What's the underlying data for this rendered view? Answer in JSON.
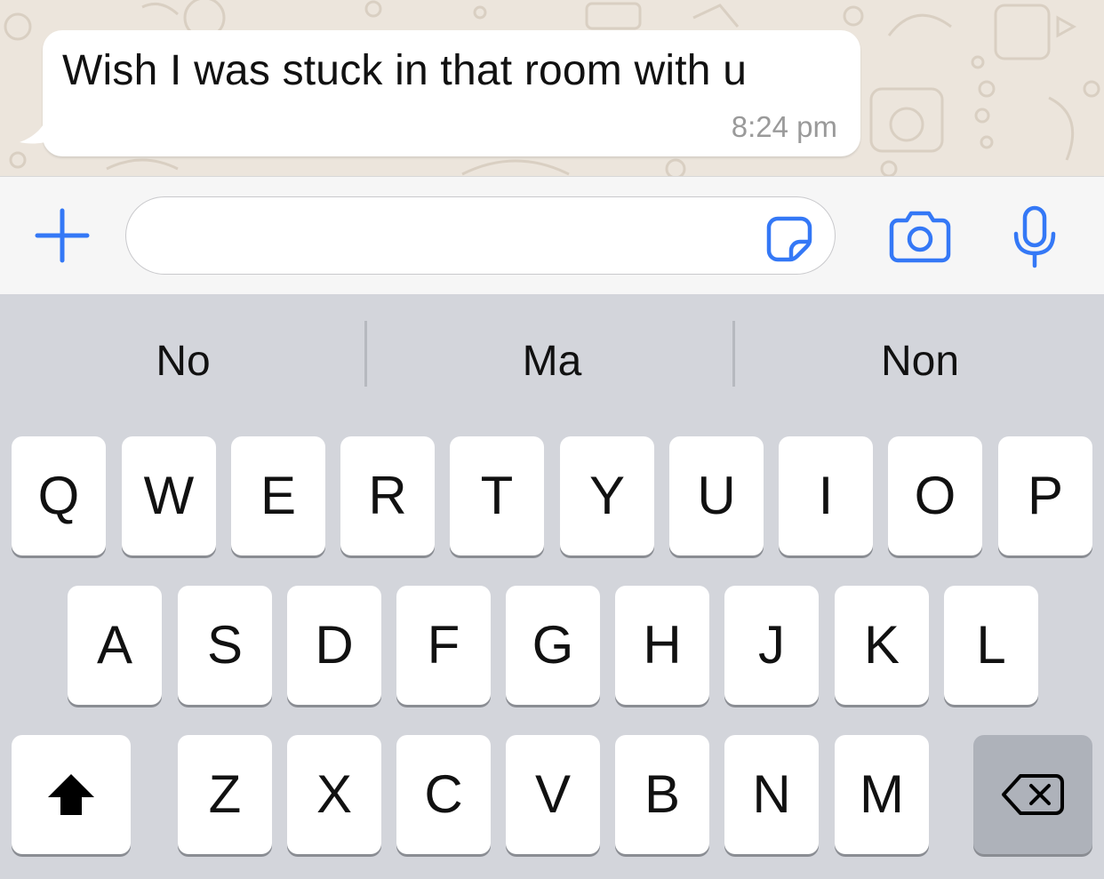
{
  "chat": {
    "message": {
      "text": "Wish I was stuck in that room with u",
      "time": "8:24 pm"
    }
  },
  "input_bar": {
    "plus_icon": "plus-icon",
    "text_field_value": "",
    "sticker_icon": "sticker-icon",
    "camera_icon": "camera-icon",
    "mic_icon": "microphone-icon",
    "accent_color": "#3478f6"
  },
  "keyboard": {
    "suggestions": [
      "No",
      "Ma",
      "Non"
    ],
    "rows": [
      [
        "Q",
        "W",
        "E",
        "R",
        "T",
        "Y",
        "U",
        "I",
        "O",
        "P"
      ],
      [
        "A",
        "S",
        "D",
        "F",
        "G",
        "H",
        "J",
        "K",
        "L"
      ],
      [
        "Z",
        "X",
        "C",
        "V",
        "B",
        "N",
        "M"
      ]
    ],
    "shift_icon": "shift-icon",
    "delete_icon": "backspace-icon"
  }
}
